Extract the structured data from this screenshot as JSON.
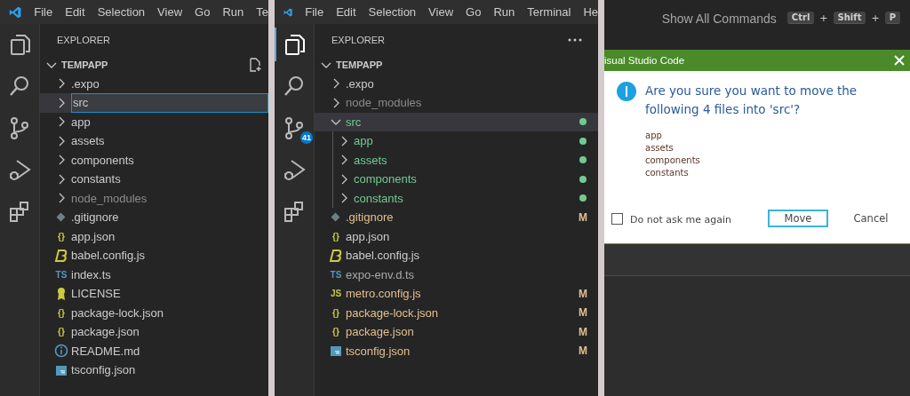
{
  "windows": [
    {
      "menu": [
        "File",
        "Edit",
        "Selection",
        "View",
        "Go",
        "Run",
        "Te"
      ],
      "activity": [
        {
          "active": false
        },
        {
          "active": false
        },
        {
          "active": false
        },
        {
          "active": false
        },
        {
          "active": false
        }
      ],
      "explorer": {
        "title": "EXPLORER",
        "root": "TEMPAPP",
        "root_expanded": true,
        "root_actions": [
          {
            "kind": "new-file"
          }
        ],
        "items": [
          {
            "kind": "folder",
            "name": ".expo",
            "expanded": false,
            "selected": false
          },
          {
            "kind": "rename",
            "value": "src",
            "expanded": false,
            "selected": true
          },
          {
            "kind": "folder",
            "name": "app",
            "expanded": false,
            "selected": false
          },
          {
            "kind": "folder",
            "name": "assets",
            "expanded": false,
            "selected": false
          },
          {
            "kind": "folder",
            "name": "components",
            "expanded": false,
            "selected": false
          },
          {
            "kind": "folder",
            "name": "constants",
            "expanded": false,
            "selected": false
          },
          {
            "kind": "folder",
            "name": "node_modules",
            "expanded": false,
            "selected": false,
            "color": "#8b8b8b"
          },
          {
            "kind": "git",
            "name": ".gitignore",
            "selected": false
          },
          {
            "kind": "json",
            "name": "app.json",
            "icon_text": "{}",
            "selected": false
          },
          {
            "kind": "babel",
            "name": "babel.config.js",
            "selected": false
          },
          {
            "kind": "ts",
            "name": "index.ts",
            "icon_text": "TS",
            "selected": false
          },
          {
            "kind": "license",
            "name": "LICENSE",
            "selected": false
          },
          {
            "kind": "json",
            "name": "package-lock.json",
            "icon_text": "{}",
            "selected": false
          },
          {
            "kind": "json",
            "name": "package.json",
            "icon_text": "{}",
            "selected": false
          },
          {
            "kind": "info",
            "name": "README.md",
            "selected": false
          },
          {
            "kind": "tsconfig",
            "name": "tsconfig.json",
            "selected": false
          }
        ]
      }
    },
    {
      "menu": [
        "File",
        "Edit",
        "Selection",
        "View",
        "Go",
        "Run",
        "Terminal",
        "He"
      ],
      "activity": [
        {
          "active": true
        },
        {
          "active": false
        },
        {
          "active": false,
          "badge": "41"
        },
        {
          "active": false
        },
        {
          "active": false
        }
      ],
      "explorer": {
        "title": "EXPLORER",
        "root": "TEMPAPP",
        "root_expanded": true,
        "header_actions": [
          {
            "kind": "more"
          }
        ],
        "items": [
          {
            "kind": "folder",
            "name": ".expo",
            "expanded": false,
            "selected": false
          },
          {
            "kind": "folder",
            "name": "node_modules",
            "expanded": false,
            "selected": false,
            "color": "#8b8b8b"
          },
          {
            "kind": "folder",
            "name": "src",
            "expanded": true,
            "selected": true,
            "color": "#73c991",
            "dot": true,
            "children": [
              {
                "kind": "folder",
                "name": "app",
                "expanded": false,
                "selected": false,
                "color": "#73c991",
                "dot": true
              },
              {
                "kind": "folder",
                "name": "assets",
                "expanded": false,
                "selected": false,
                "color": "#73c991",
                "dot": true
              },
              {
                "kind": "folder",
                "name": "components",
                "expanded": false,
                "selected": false,
                "color": "#73c991",
                "dot": true
              },
              {
                "kind": "folder",
                "name": "constants",
                "expanded": false,
                "selected": false,
                "color": "#73c991",
                "dot": true
              }
            ]
          },
          {
            "kind": "git",
            "name": ".gitignore",
            "selected": false,
            "color": "#e2c08d",
            "badge": "M"
          },
          {
            "kind": "json",
            "name": "app.json",
            "icon_text": "{}",
            "selected": false
          },
          {
            "kind": "babel",
            "name": "babel.config.js",
            "selected": false
          },
          {
            "kind": "ts",
            "name": "expo-env.d.ts",
            "icon_text": "TS",
            "selected": false,
            "color": "#a9a9a9"
          },
          {
            "kind": "js",
            "name": "metro.config.js",
            "icon_text": "JS",
            "selected": false,
            "color": "#e2c08d",
            "badge": "M"
          },
          {
            "kind": "json",
            "name": "package-lock.json",
            "icon_text": "{}",
            "selected": false,
            "color": "#e2c08d",
            "badge": "M"
          },
          {
            "kind": "json",
            "name": "package.json",
            "icon_text": "{}",
            "selected": false,
            "color": "#e2c08d",
            "badge": "M"
          },
          {
            "kind": "tsconfig",
            "name": "tsconfig.json",
            "selected": false,
            "color": "#e2c08d",
            "badge": "M"
          }
        ]
      }
    }
  ],
  "shortcut": {
    "label": "Show All Commands",
    "keys": [
      "Ctrl",
      "Shift",
      "P"
    ],
    "separator": "+"
  },
  "dialog": {
    "title": "isual Studio Code",
    "message": "Are you sure you want to move the following 4 files into 'src'?",
    "details": [
      "app",
      "assets",
      "components",
      "constants"
    ],
    "checkbox": {
      "label": "Do not ask me again",
      "checked": false
    },
    "buttons": [
      {
        "label": "Move",
        "default": true
      },
      {
        "label": "Cancel",
        "default": false
      }
    ]
  }
}
